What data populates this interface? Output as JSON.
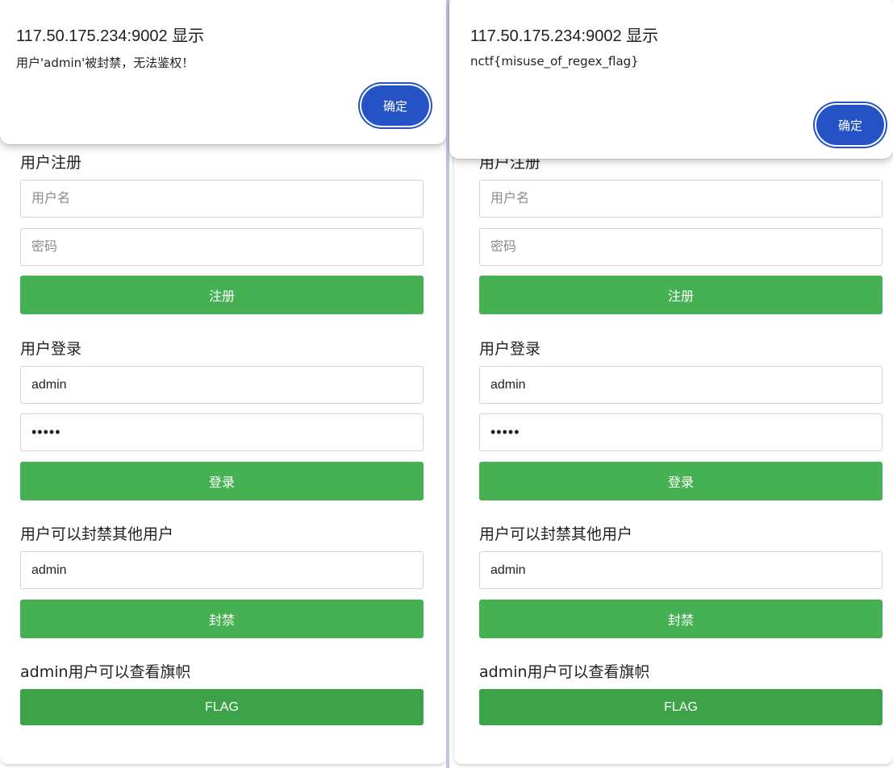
{
  "windows": [
    {
      "dialog": {
        "title": "117.50.175.234:9002 显示",
        "message": "用户'admin'被封禁，无法鉴权！",
        "ok_label": "确定"
      },
      "register": {
        "title": "用户注册",
        "username_placeholder": "用户名",
        "password_placeholder": "密码",
        "button": "注册"
      },
      "login": {
        "title": "用户登录",
        "username_value": "admin",
        "password_value": "admin",
        "button": "登录"
      },
      "ban": {
        "title": "用户可以封禁其他用户",
        "username_value": "admin",
        "button": "封禁"
      },
      "flag": {
        "title": "admin用户可以查看旗帜",
        "button": "FLAG"
      }
    },
    {
      "dialog": {
        "title": "117.50.175.234:9002 显示",
        "message": "nctf{misuse_of_regex_flag}",
        "ok_label": "确定"
      },
      "register": {
        "title": "用户注册",
        "username_placeholder": "用户名",
        "password_placeholder": "密码",
        "button": "注册"
      },
      "login": {
        "title": "用户登录",
        "username_value": "admin",
        "password_value": "admin",
        "button": "登录"
      },
      "ban": {
        "title": "用户可以封禁其他用户",
        "username_value": "admin",
        "button": "封禁"
      },
      "flag": {
        "title": "admin用户可以查看旗帜",
        "button": "FLAG"
      }
    }
  ],
  "colors": {
    "button_green": "#45b153",
    "flag_green": "#3da349",
    "dialog_blue": "#2553c5"
  }
}
